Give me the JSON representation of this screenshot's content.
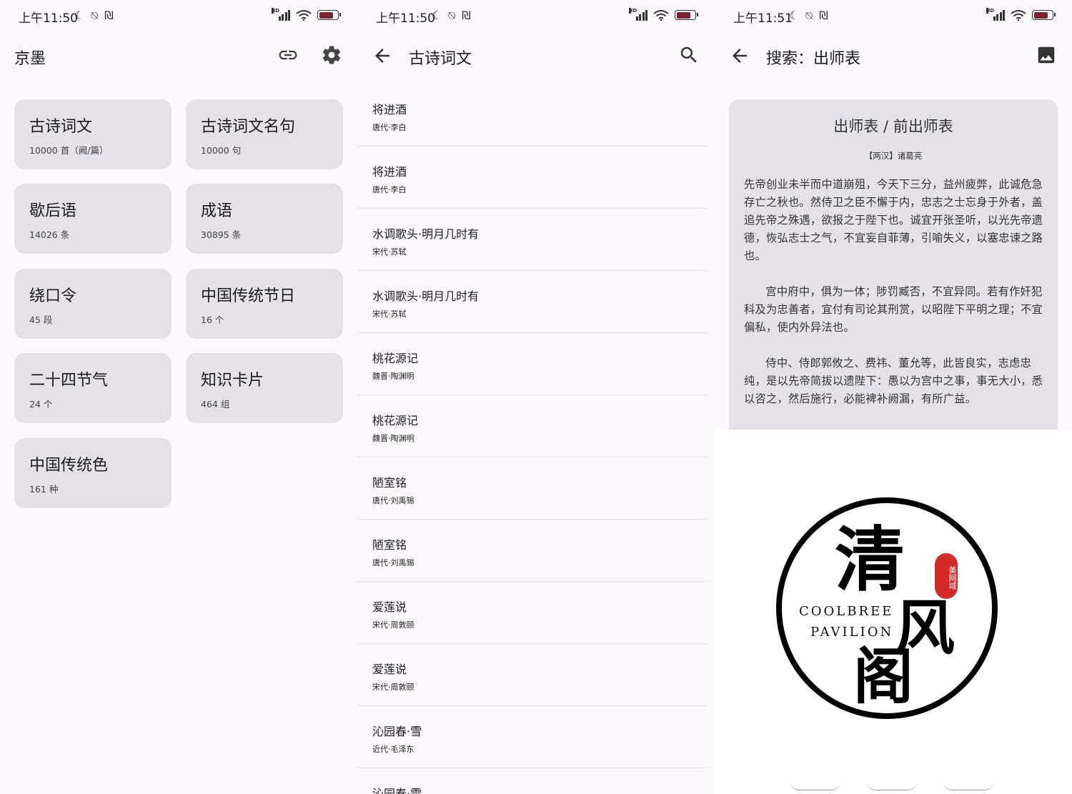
{
  "status": {
    "time1": "上午11:50",
    "time2": "上午11:50",
    "time3": "上午11:51",
    "icons": "☾ ⍉ ₪",
    "hd": "HD",
    "battery_level": 0.78,
    "battery_color": "#7a2431"
  },
  "screen1": {
    "title": "京墨",
    "cards": [
      {
        "title": "古诗词文",
        "count": "10000 首（阙/篇）"
      },
      {
        "title": "古诗词文名句",
        "count": "10000 句"
      },
      {
        "title": "歇后语",
        "count": "14026 条"
      },
      {
        "title": "成语",
        "count": "30895 条"
      },
      {
        "title": "绕口令",
        "count": "45 段"
      },
      {
        "title": "中国传统节日",
        "count": "16 个"
      },
      {
        "title": "二十四节气",
        "count": "24 个"
      },
      {
        "title": "知识卡片",
        "count": "464 组"
      },
      {
        "title": "中国传统色",
        "count": "161 种"
      }
    ]
  },
  "screen2": {
    "title": "古诗词文",
    "items": [
      {
        "title": "将进酒",
        "author": "唐代·李白"
      },
      {
        "title": "将进酒",
        "author": "唐代·李白"
      },
      {
        "title": "水调歌头·明月几时有",
        "author": "宋代·苏轼"
      },
      {
        "title": "水调歌头·明月几时有",
        "author": "宋代·苏轼"
      },
      {
        "title": "桃花源记",
        "author": "魏晋·陶渊明"
      },
      {
        "title": "桃花源记",
        "author": "魏晋·陶渊明"
      },
      {
        "title": "陋室铭",
        "author": "唐代·刘禹锡"
      },
      {
        "title": "陋室铭",
        "author": "唐代·刘禹锡"
      },
      {
        "title": "爱莲说",
        "author": "宋代·周敦颐"
      },
      {
        "title": "爱莲说",
        "author": "宋代·周敦颐"
      },
      {
        "title": "沁园春·雪",
        "author": "近代·毛泽东"
      },
      {
        "title": "沁园春·雪",
        "author": ""
      }
    ]
  },
  "screen3": {
    "title": "搜索：出师表",
    "poem_title": "出师表 / 前出师表",
    "poem_author": "【两汉】诸葛亮",
    "paragraphs": [
      "先帝创业未半而中道崩殂，今天下三分，益州疲弊，此诚危急存亡之秋也。然侍卫之臣不懈于内，忠志之士忘身于外者，盖追先帝之殊遇，欲报之于陛下也。诚宜开张圣听，以光先帝遗德，恢弘志士之气，不宜妄自菲薄，引喻失义，以塞忠谏之路也。",
      "宫中府中，俱为一体；陟罚臧否，不宜异同。若有作奸犯科及为忠善者，宜付有司论其刑赏，以昭陛下平明之理；不宜偏私，使内外异法也。",
      "侍中、侍郎郭攸之、费祎、董允等，此皆良实，志虑忠纯，是以先帝简拔以遗陛下：愚以为宫中之事，事无大小，悉以咨之，然后施行，必能裨补阙漏，有所广益。"
    ]
  },
  "watermark": {
    "char1": "清",
    "char2": "风",
    "char3": "阁",
    "line1": "COOLBREE",
    "line2": "PAVILION",
    "stamp": "美网域",
    "stamp_color": "#d42a2a"
  }
}
